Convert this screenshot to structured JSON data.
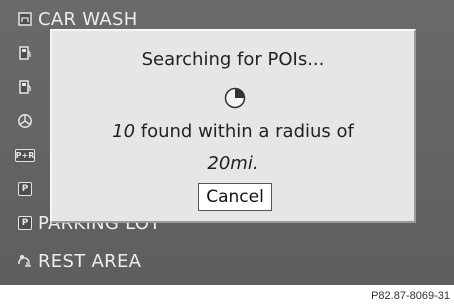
{
  "list": {
    "items": [
      {
        "icon": "car-wash-icon",
        "label": "CAR WASH"
      },
      {
        "icon": "fuel-icon",
        "label": ""
      },
      {
        "icon": "fuel-icon",
        "label": ""
      },
      {
        "icon": "mercedes-icon",
        "label": ""
      },
      {
        "icon": "park-and-ride-icon",
        "label": ""
      },
      {
        "icon": "parking-icon",
        "label": ""
      },
      {
        "icon": "parking-icon",
        "label": "PARKING LOT"
      },
      {
        "icon": "rest-area-icon",
        "label": "REST AREA"
      }
    ]
  },
  "dialog": {
    "title": "Searching for POIs...",
    "count": "10",
    "found_text": " found within a radius of",
    "radius": "20mi.",
    "cancel_label": "Cancel"
  },
  "icons": {
    "park_and_ride": "P+R",
    "parking": "P"
  },
  "caption": "P82.87-8069-31"
}
